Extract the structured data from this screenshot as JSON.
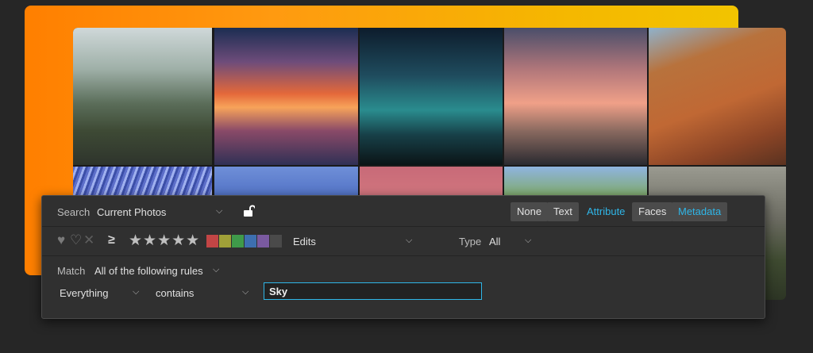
{
  "search": {
    "label": "Search",
    "scope_value": "Current Photos",
    "filter_buttons": [
      "None",
      "Text",
      "Attribute",
      "Faces",
      "Metadata"
    ]
  },
  "filters": {
    "comparator": "≥",
    "stars": "★★★★★",
    "color_labels": [
      "#c24545",
      "#a0a038",
      "#3f9a4a",
      "#3d6fb0",
      "#7a5aa0",
      "#4a4a4a"
    ],
    "edits_label": "Edits",
    "type_label": "Type",
    "type_value": "All"
  },
  "match": {
    "label": "Match",
    "rule_mode": "All of the following rules"
  },
  "rule": {
    "field": "Everything",
    "operator": "contains",
    "value": "Sky"
  },
  "colors": {
    "accent": "#2fb6e8",
    "panel": "#303030"
  }
}
